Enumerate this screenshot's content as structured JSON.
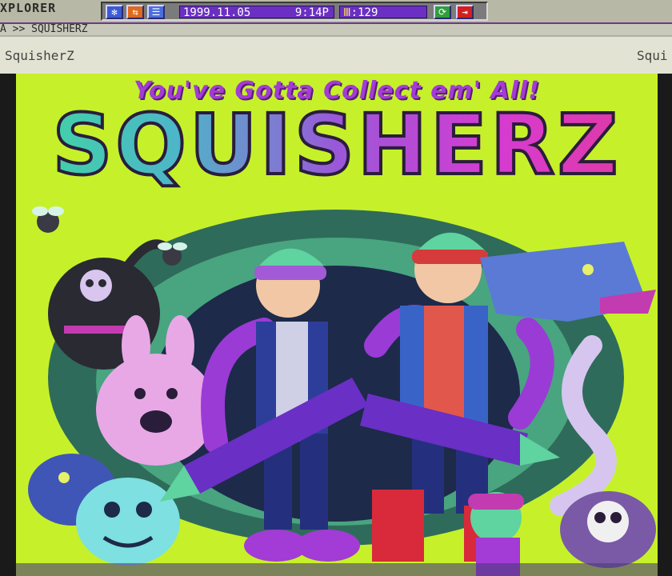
{
  "window": {
    "app_title": "XPLORER",
    "address": "A >> SQUISHERZ"
  },
  "tray": {
    "date": "1999.11.05",
    "time": "9:14P",
    "count_icon": "Ⅲ",
    "count": "129"
  },
  "tabs": {
    "left": "SquisherZ",
    "right": "Squi"
  },
  "poster": {
    "tagline": "You've Gotta Collect em' All!",
    "logo": "SQUISHERZ"
  },
  "colors": {
    "lime_background": "#c6f12a",
    "accent_purple": "#6b2fc4",
    "logo_teal": "#3fd7a0",
    "logo_pink": "#e23a9c"
  }
}
